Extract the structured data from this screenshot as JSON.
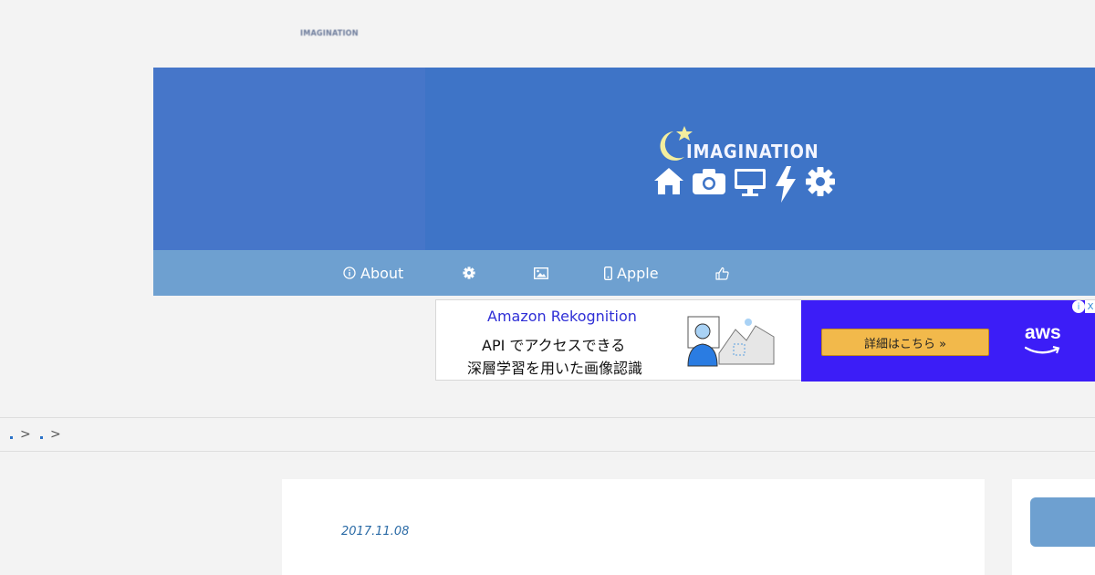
{
  "site": {
    "top_logo_text": "IMAGINATION",
    "brand_title": "IMAGINATION"
  },
  "brand_icons": [
    "moon-star-icon",
    "home-icon",
    "camera-icon",
    "monitor-icon",
    "bolt-icon",
    "gear-icon"
  ],
  "nav": {
    "items": [
      {
        "label": "About",
        "icon": "info-icon"
      },
      {
        "label": "",
        "icon": "gear-icon"
      },
      {
        "label": "",
        "icon": "image-icon"
      },
      {
        "label": "Apple",
        "icon": "mobile-icon"
      },
      {
        "label": "",
        "icon": "thumbs-up-icon"
      }
    ]
  },
  "ad": {
    "title": "Amazon Rekognition",
    "line1": "API でアクセスできる",
    "line2": "深層学習を用いた画像認識",
    "button": "詳細はこちら »",
    "brand": "aws",
    "info": "i",
    "close": "X",
    "accent": "#3c1df7"
  },
  "breadcrumb": {
    "separators": [
      ">",
      ">"
    ]
  },
  "article": {
    "date": "2017.11.08"
  },
  "colors": {
    "header": "#3e74c7",
    "nav": "#6ea0d0",
    "background": "#f3f3f3"
  }
}
